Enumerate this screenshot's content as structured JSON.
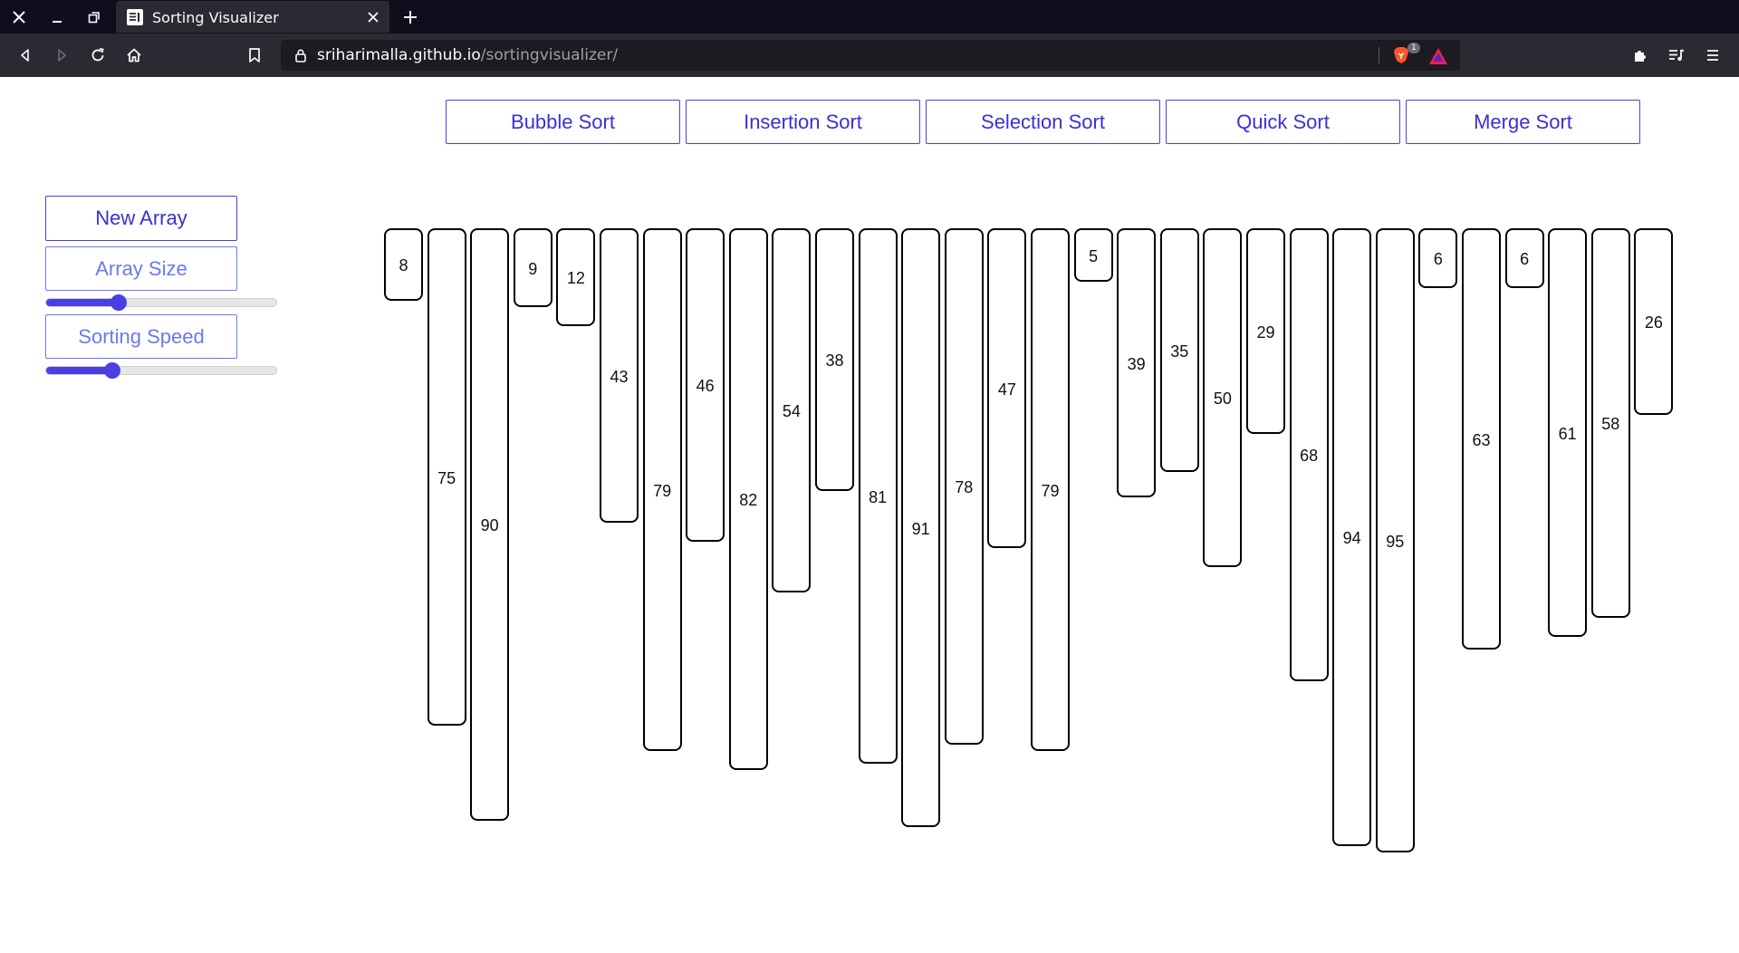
{
  "browser": {
    "tab_title": "Sorting Visualizer",
    "url_host": "sriharimalla.github.io",
    "url_path": "/sortingvisualizer/",
    "shields_badge": "1"
  },
  "algorithms": {
    "bubble": "Bubble Sort",
    "insertion": "Insertion Sort",
    "selection": "Selection Sort",
    "quick": "Quick Sort",
    "merge": "Merge Sort"
  },
  "controls": {
    "new_array": "New Array",
    "array_size": "Array Size",
    "array_size_value": 0.3,
    "sorting_speed": "Sorting Speed",
    "sorting_speed_value": 0.27
  },
  "colors": {
    "accent": "#4a3fe0",
    "accent_light": "#6a79ee",
    "bar_border": "#000000"
  },
  "array": [
    8,
    75,
    90,
    9,
    12,
    43,
    79,
    46,
    82,
    54,
    38,
    81,
    91,
    78,
    47,
    79,
    5,
    39,
    35,
    50,
    29,
    68,
    94,
    95,
    6,
    63,
    6,
    61,
    58,
    26
  ]
}
